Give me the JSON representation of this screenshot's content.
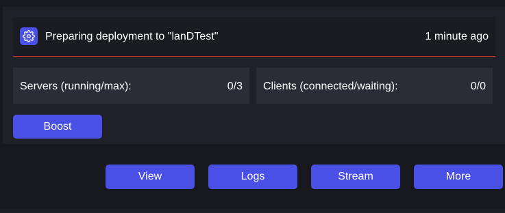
{
  "deployment": {
    "status_text": "Preparing deployment to \"lanDTest\"",
    "time_ago": "1 minute ago",
    "status_icon": "gear-icon"
  },
  "stats": {
    "servers_label": "Servers (running/max):",
    "servers_value": "0/3",
    "clients_label": "Clients (connected/waiting):",
    "clients_value": "0/0"
  },
  "actions": {
    "boost_label": "Boost",
    "view_label": "View",
    "logs_label": "Logs",
    "stream_label": "Stream",
    "more_label": "More"
  },
  "colors": {
    "accent": "#4a4fe6",
    "divider": "#d93434",
    "background": "#16181d",
    "card": "#1f2128",
    "stat_box": "#2a2d36"
  }
}
